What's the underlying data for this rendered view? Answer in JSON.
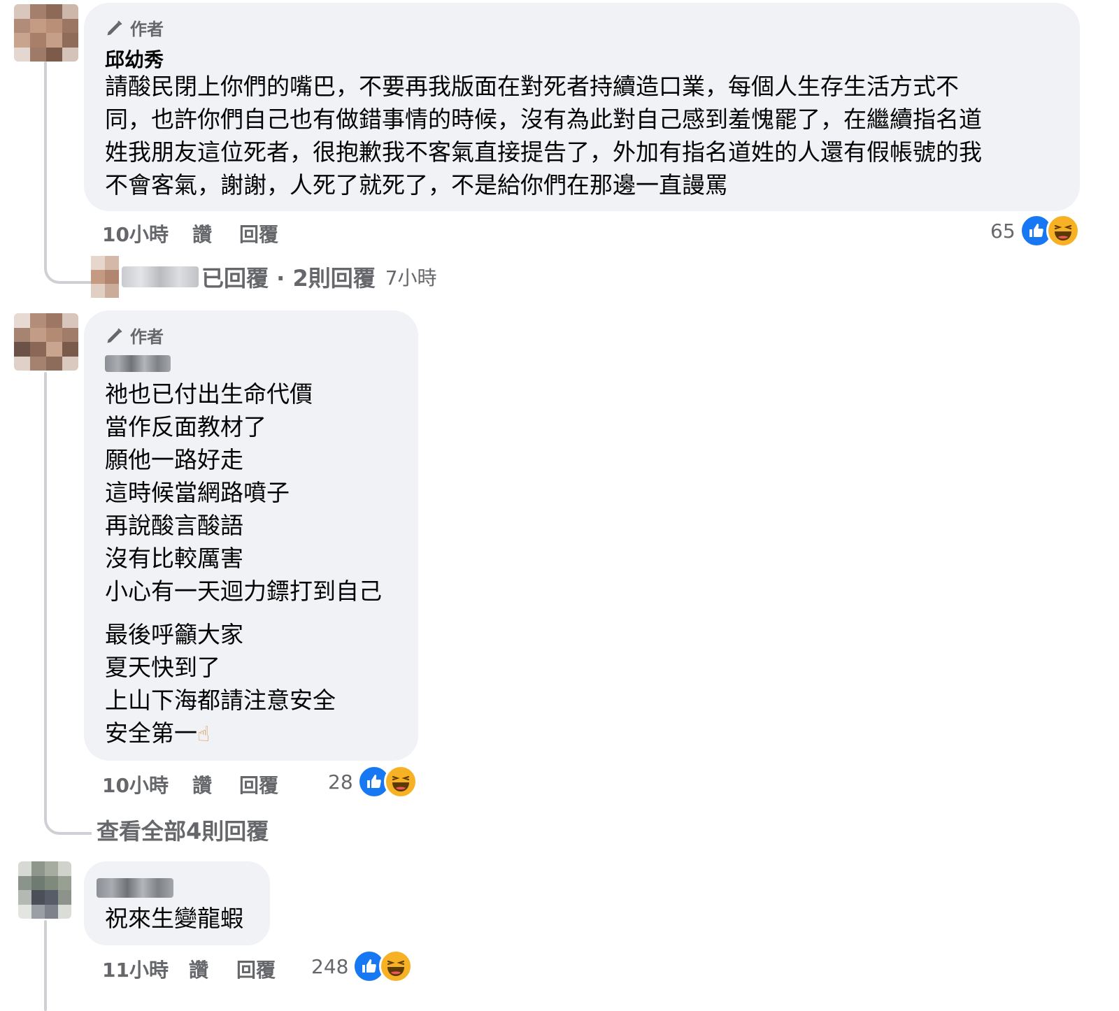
{
  "comments": [
    {
      "badge": "作者",
      "name": "邱幼秀",
      "text": "請酸民閉上你們的嘴巴，不要再我版面在對死者持續造口業，每個人生存生活方式不\n同，也許你們自己也有做錯事情的時候，沒有為此對自己感到羞愧罷了，在繼續指名道\n姓我朋友這位死者，很抱歉我不客氣直接提告了，外加有指名道姓的人還有假帳號的我\n不會客氣，謝謝，人死了就死了，不是給你們在那邊一直謾罵",
      "time": "10小時",
      "like": "讚",
      "reply": "回覆",
      "reactions": "65",
      "replies_summary": "已回覆 · 2則回覆",
      "replies_time": "7小時"
    },
    {
      "badge": "作者",
      "text_a": "祂也已付出生命代價\n當作反面教材了\n願他一路好走\n這時候當網路噴子\n再說酸言酸語\n沒有比較厲害\n小心有一天迴力鏢打到自己",
      "text_b": "最後呼籲大家\n夏天快到了\n上山下海都請注意安全\n安全第一",
      "emoji": "☝",
      "time": "10小時",
      "like": "讚",
      "reply": "回覆",
      "reactions": "28",
      "view_all": "查看全部4則回覆"
    },
    {
      "text": "祝來生變龍蝦",
      "time": "11小時",
      "like": "讚",
      "reply": "回覆",
      "reactions": "248"
    }
  ],
  "colors": {
    "like": "#1877f2",
    "haha": "#f7b125",
    "bubble": "#f0f2f5",
    "meta": "#65676b"
  },
  "icons": [
    "pencil-icon",
    "like-reaction-icon",
    "haha-reaction-icon"
  ]
}
